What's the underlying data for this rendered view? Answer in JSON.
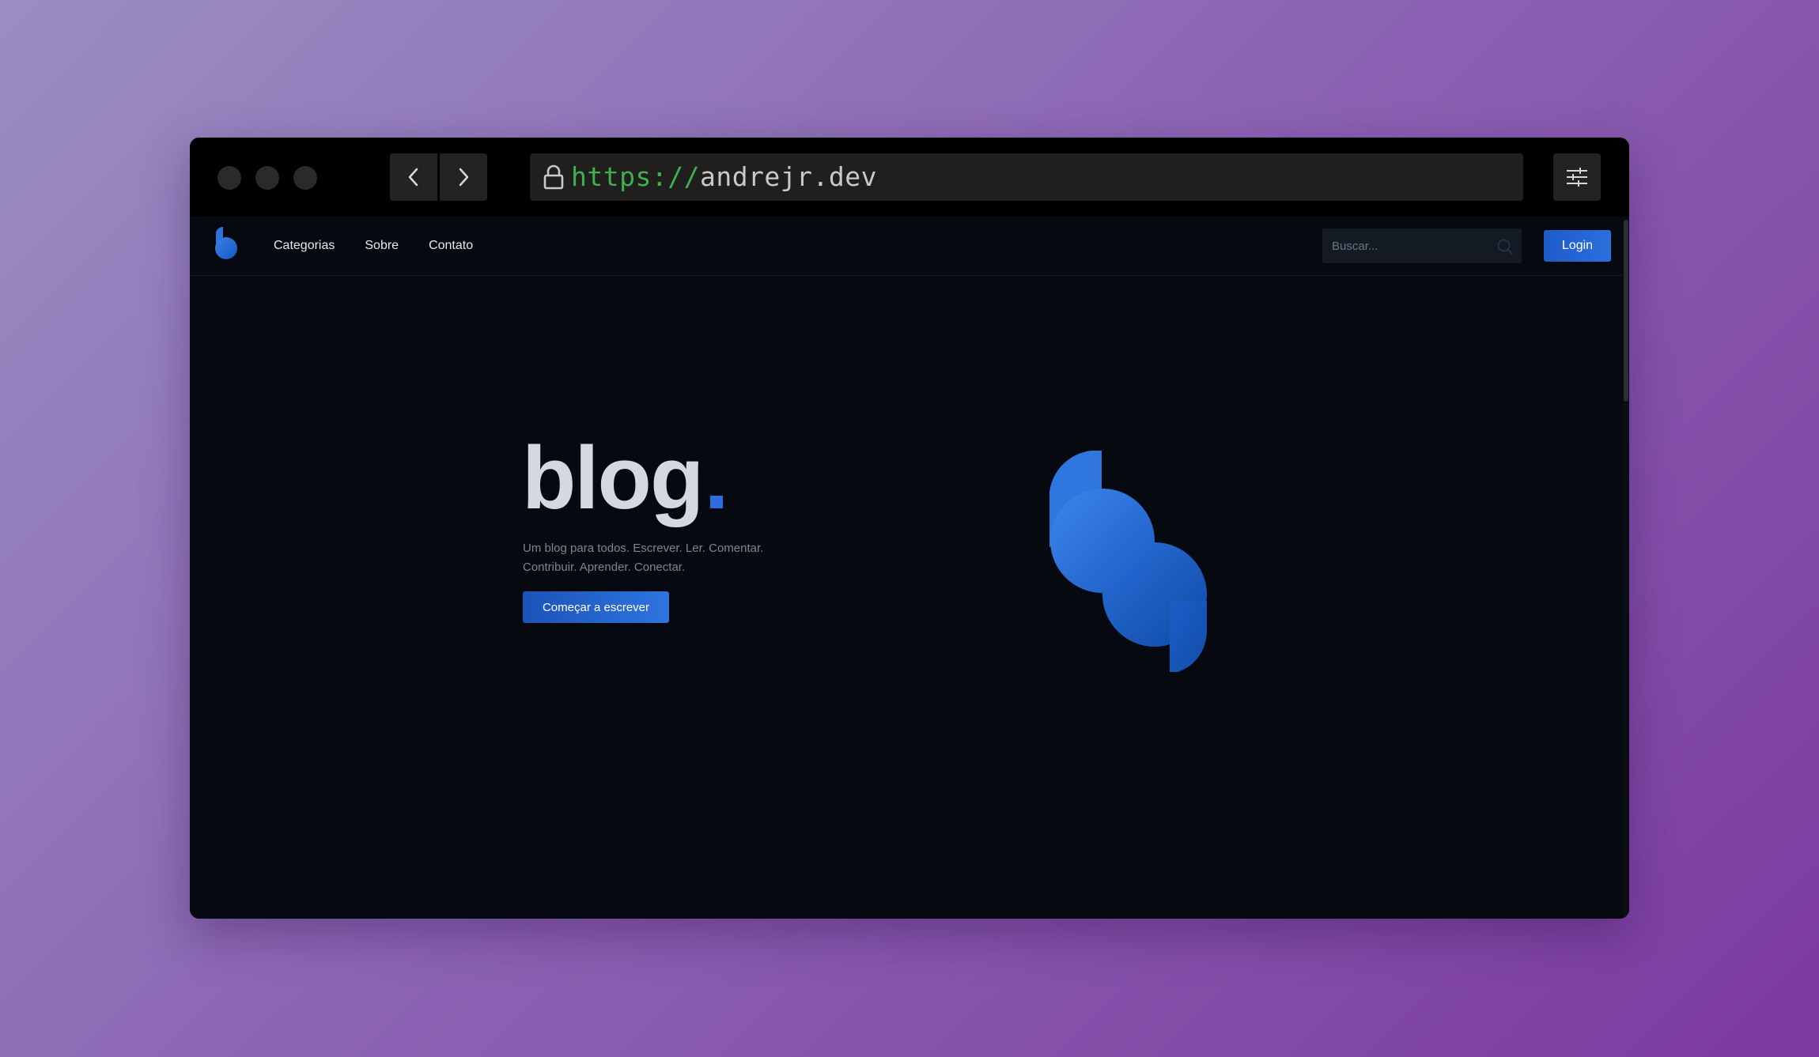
{
  "browser": {
    "url_scheme": "https://",
    "url_host": "andrejr.dev"
  },
  "site": {
    "nav": {
      "items": [
        {
          "label": "Categorias"
        },
        {
          "label": "Sobre"
        },
        {
          "label": "Contato"
        }
      ]
    },
    "search": {
      "placeholder": "Buscar...",
      "value": ""
    },
    "login_label": "Login"
  },
  "hero": {
    "title": "blog",
    "tagline": "Um blog para todos. Escrever. Ler. Comentar. Contribuir. Aprender. Conectar.",
    "cta_label": "Começar a escrever"
  },
  "colors": {
    "accent": "#2a6ee0",
    "page_background": "#060910",
    "url_scheme": "#3db14f"
  },
  "icons": {
    "lock": "lock-icon",
    "back": "chevron-left-icon",
    "forward": "chevron-right-icon",
    "settings": "sliders-icon",
    "search": "search-icon"
  }
}
